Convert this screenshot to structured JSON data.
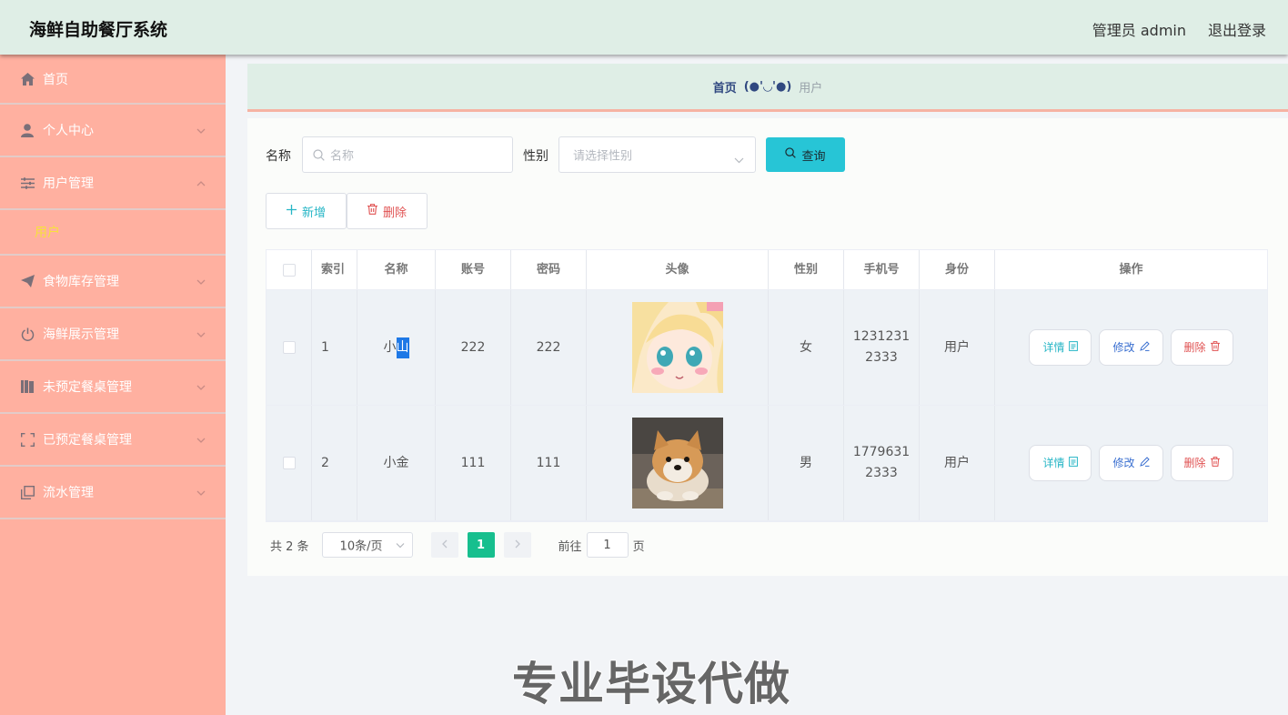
{
  "header": {
    "title": "海鲜自助餐厅系统",
    "admin": "管理员 admin",
    "logout": "退出登录"
  },
  "sidebar": {
    "items": [
      {
        "label": "首页",
        "icon": "home-icon"
      },
      {
        "label": "个人中心",
        "icon": "user-icon"
      },
      {
        "label": "用户管理",
        "icon": "sliders-icon",
        "expanded": true,
        "sub": "用户"
      },
      {
        "label": "食物库存管理",
        "icon": "send-icon"
      },
      {
        "label": "海鲜展示管理",
        "icon": "power-icon"
      },
      {
        "label": "未预定餐桌管理",
        "icon": "book-icon"
      },
      {
        "label": "已预定餐桌管理",
        "icon": "fullscreen-icon"
      },
      {
        "label": "流水管理",
        "icon": "copy-icon"
      }
    ]
  },
  "breadcrumb": {
    "home": "首页",
    "face": "(●'◡'●)",
    "current": "用户"
  },
  "search": {
    "name_label": "名称",
    "name_placeholder": "名称",
    "gender_label": "性别",
    "gender_placeholder": "请选择性别",
    "query": "查询"
  },
  "toolbar": {
    "add": "新增",
    "delete": "删除"
  },
  "table": {
    "headers": [
      "",
      "索引",
      "名称",
      "账号",
      "密码",
      "头像",
      "性别",
      "手机号",
      "身份",
      "操作"
    ],
    "rows": [
      {
        "index": "1",
        "name": "小",
        "name_selected": "山",
        "account": "222",
        "password": "222",
        "avatar": "anime-girl-avatar",
        "gender": "女",
        "phone": "12312312333",
        "role": "用户"
      },
      {
        "index": "2",
        "name": "小金",
        "account": "111",
        "password": "111",
        "avatar": "shiba-dog-avatar",
        "gender": "男",
        "phone": "17796312333",
        "role": "用户"
      }
    ],
    "actions": {
      "detail": "详情",
      "edit": "修改",
      "delete": "删除"
    }
  },
  "pagination": {
    "total": "共 2 条",
    "page_size": "10条/页",
    "current": "1",
    "goto_prefix": "前往",
    "goto_value": "1",
    "goto_suffix": "页"
  },
  "watermark": "专业毕设代做",
  "colors": {
    "header_bg": "#dfeee6",
    "sidebar_bg": "#ffb0a0",
    "active_sub": "#f7e13c",
    "query_btn": "#27c5d6",
    "page_active": "#17bf8e"
  }
}
